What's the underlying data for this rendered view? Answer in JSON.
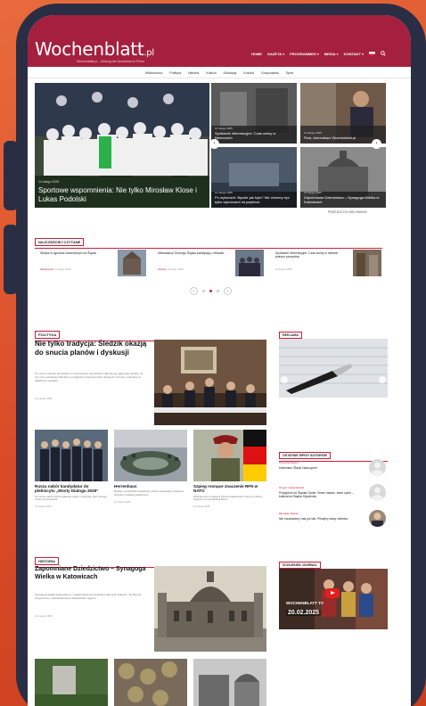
{
  "site": {
    "logo_text": "Wochenblatt",
    "logo_suffix": ".pl",
    "tagline": "Wochenblatt.pl – Zeitung der Deutschen in Polen"
  },
  "top_nav": [
    "HOME",
    "GAZETA ▾",
    "PROGRAMMES ▾",
    "MEDIA ▾",
    "KONTAKT ▾"
  ],
  "sub_nav": [
    "Wiadomości",
    "Polityka",
    "Historia",
    "Kultura",
    "Edukacja",
    "Kościół",
    "Gospodarka",
    "Sport"
  ],
  "hero": {
    "main": {
      "title": "Sportowe wspomnienia: Nie tylko Mirosław Klose i Lukas Podolski",
      "date": "14 lutego 2025"
    },
    "small": [
      {
        "title": "Spotkanie informacyjne: Czas wolny w Niemczech",
        "date": "13 lutego 2025"
      },
      {
        "title": "Piotr, dziennikarz Wochenblatt.pl",
        "date": "13 lutego 2025"
      },
      {
        "title": "Po wyborach: Będzie jak było? Nie chcemy być tylko wyborcami na papierze",
        "date": "12 lutego 2025"
      },
      {
        "title": "Zapomniane Dziedzictwo – Synagoga Wielka w Katowicach",
        "date": "12 lutego 2025"
      }
    ],
    "more_label": "PRZEJDŹ DO ARCHIWUM"
  },
  "most_read": {
    "heading": "NAJCZĘŚCIEJ CZYTANE",
    "items": [
      {
        "title": "Wizyta w ogrodzie botanicznym na Śląsku",
        "category": "Wiadomości",
        "date": "11 lutego 2025"
      },
      {
        "title": "Mieszkańcy Górnego Śląska pamiętają o ofiarach",
        "category": "Historia",
        "date": "10 lutego 2025"
      },
      {
        "title": "Spotkanie informacyjne: Czas wolny w mieście pełnym pomysłów",
        "category": "",
        "date": "10 lutego 2025"
      }
    ]
  },
  "polityka": {
    "section": "POLITYKA",
    "main": {
      "title": "Nie tylko tradycja: Śledzik okazją do snucia planów i dyskusji",
      "excerpt": "Co roku w okresie karnawału w zrzeszeniach niemieckich odbywa się tradycyjny śledzik. W tym roku spotkanie członków i przyjaciół mniejszości było okazją do rozmów o planach na najbliższe miesiące.",
      "date": "14 lutego 2025"
    },
    "grid": [
      {
        "title": "Rusza nabór kandydatur do plebiscytu „Mosty Dialogu 2025”",
        "excerpt": "Do końca marca można zgłaszać osoby i instytucje, które budują mosty porozumienia.",
        "date": "13 lutego 2025"
      },
      {
        "title": "Herrenhaus",
        "excerpt": "Debata o przyszłości współpracy polsko-niemieckiej w dawnym budynku pruskiego parlamentu.",
        "date": "12 lutego 2025"
      },
      {
        "title": "Szpieg rosnące znaczenie RFN w NATO",
        "excerpt": "Rola Niemiec w Sojuszu Północnoatlantyckim rośnie w obliczu zagrożeń na wschodniej flance.",
        "date": "11 lutego 2025"
      }
    ]
  },
  "historia": {
    "section": "HISTORIA",
    "main": {
      "title": "Zapomniane Dziedzictwo – Synagoga Wielka w Katowicach",
      "excerpt": "Synagoga Wielka była jednym z najważniejszych budynków dawnych Katowic. Jej historia przypomina o wielokulturowym dziedzictwie regionu.",
      "date": "12 lutego 2025"
    }
  },
  "sidebar": {
    "ad_heading": "REKLAMA",
    "comments_heading": "OSTATNIE WPISY AUTORÓW",
    "comments": [
      {
        "author": "Krzysztof Świerc",
        "title": "Kalendarz Śląski Nauczyciel"
      },
      {
        "author": "Gregor Lewandowski",
        "title": "Przyjdźcie do Śląska Opole: Nowe miasto, stare życie – kulturalna Śląska Stypendia"
      },
      {
        "author": "Mirosław Ślęzak",
        "title": "Nie zauważamy nas już tak: Pilnujmy wiary dziecka"
      }
    ],
    "sj_heading": "SCHLESIEN JOURNAL",
    "sj_logo": "WOCHENBLATT TV",
    "sj_date": "20.02.2025"
  },
  "colors": {
    "brand": "#a5203f",
    "accent": "#c8203c",
    "frame": "#2a2e45",
    "background": "#e0552f"
  }
}
